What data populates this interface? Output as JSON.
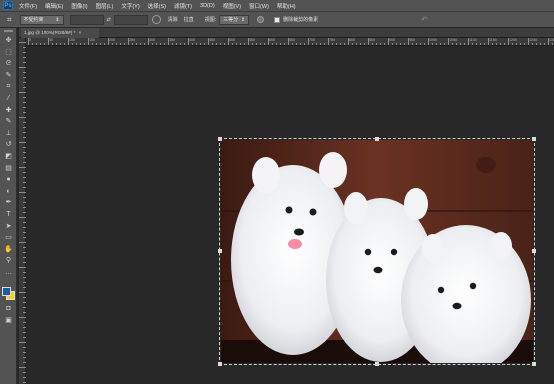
{
  "menubar": {
    "logo": "Ps",
    "items": [
      "文件(F)",
      "编辑(E)",
      "图像(I)",
      "图层(L)",
      "文字(Y)",
      "选择(S)",
      "滤镜(T)",
      "3D(D)",
      "视图(V)",
      "窗口(W)",
      "帮助(H)"
    ]
  },
  "options": {
    "ratio_select": "不受约束",
    "clear_label": "清除",
    "straighten_label": "拉直",
    "view_label": "视图:",
    "view_value": "三等分",
    "delete_cropped_label": "删除裁剪的像素"
  },
  "document": {
    "tab_label": "1.jpg @ 100%(RGB/8#) *",
    "tab_close": "×"
  },
  "ruler": {
    "h_numbers": [
      "0",
      "50",
      "100",
      "150",
      "200",
      "250",
      "300",
      "350",
      "400",
      "450",
      "500",
      "550",
      "600",
      "650",
      "700",
      "750",
      "800",
      "850",
      "900",
      "950",
      "1000",
      "1050",
      "1100",
      "1150",
      "1200",
      "1250",
      "1300"
    ]
  },
  "tools": [
    {
      "name": "move-tool-icon",
      "glyph": "✥"
    },
    {
      "name": "marquee-tool-icon",
      "glyph": "⬚"
    },
    {
      "name": "lasso-tool-icon",
      "glyph": "ᘓ"
    },
    {
      "name": "quick-select-tool-icon",
      "glyph": "✎"
    },
    {
      "name": "crop-tool-icon",
      "glyph": "⌗"
    },
    {
      "name": "eyedropper-tool-icon",
      "glyph": "⁄"
    },
    {
      "name": "healing-brush-tool-icon",
      "glyph": "✚"
    },
    {
      "name": "brush-tool-icon",
      "glyph": "✎"
    },
    {
      "name": "clone-stamp-tool-icon",
      "glyph": "⊥"
    },
    {
      "name": "history-brush-tool-icon",
      "glyph": "↺"
    },
    {
      "name": "eraser-tool-icon",
      "glyph": "◩"
    },
    {
      "name": "gradient-tool-icon",
      "glyph": "▤"
    },
    {
      "name": "blur-tool-icon",
      "glyph": "●"
    },
    {
      "name": "dodge-tool-icon",
      "glyph": "◐"
    },
    {
      "name": "pen-tool-icon",
      "glyph": "✒"
    },
    {
      "name": "type-tool-icon",
      "glyph": "T"
    },
    {
      "name": "path-select-tool-icon",
      "glyph": "➤"
    },
    {
      "name": "shape-tool-icon",
      "glyph": "▭"
    },
    {
      "name": "hand-tool-icon",
      "glyph": "✋"
    },
    {
      "name": "zoom-tool-icon",
      "glyph": "⚲"
    },
    {
      "name": "edit-toolbar-icon",
      "glyph": "…"
    }
  ],
  "colors": {
    "foreground": "#1e5aa8",
    "background": "#f2d21b"
  }
}
